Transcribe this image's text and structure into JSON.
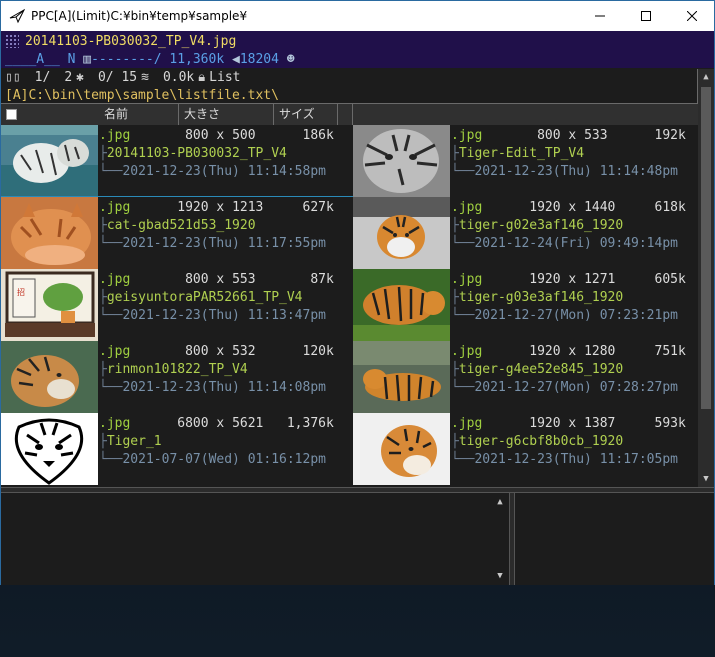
{
  "window": {
    "title": "PPC[A](Limit)C:¥bin¥temp¥sample¥",
    "icon": "paper-plane-icon",
    "minimize_icon": "minimize-icon",
    "maximize_icon": "maximize-icon",
    "close_icon": "close-icon"
  },
  "info": {
    "filename": "20141103-PB030032_TP_V4.jpg",
    "attr_line": "____A__ N ",
    "attr_rest": "--------/ 11,360k ",
    "attr_count": "18204"
  },
  "status": {
    "page": "1/",
    "marked": "2",
    "files": "0/ 15",
    "size": "0.0k",
    "mode": "List"
  },
  "path": "[A]C:\\bin\\temp\\sample\\listfile.txt\\",
  "columns": {
    "name": "名前",
    "size_wh": "大きさ",
    "size": "サイズ"
  },
  "entries": [
    {
      "ext": ".jpg",
      "dims": "800 x 500",
      "size": "186k",
      "name": "20141103-PB030032_TP_V4",
      "date": "2021-12-23(Thu) 11:14:58pm",
      "thumb": "white-tiger"
    },
    {
      "ext": ".jpg",
      "dims": "800 x 533",
      "size": "192k",
      "name": "Tiger-Edit_TP_V4",
      "date": "2021-12-23(Thu) 11:14:48pm",
      "thumb": "tiger-face-bw"
    },
    {
      "ext": ".jpg",
      "dims": "1920 x 1213",
      "size": "627k",
      "name": "cat-gbad521d53_1920",
      "date": "2021-12-23(Thu) 11:17:55pm",
      "thumb": "orange-cat"
    },
    {
      "ext": ".jpg",
      "dims": "1920 x 1440",
      "size": "618k",
      "name": "tiger-g02e3af146_1920",
      "date": "2021-12-24(Fri) 09:49:14pm",
      "thumb": "tiger-snow"
    },
    {
      "ext": ".jpg",
      "dims": "800 x 553",
      "size": "87k",
      "name": "geisyuntoraPAR52661_TP_V4",
      "date": "2021-12-23(Thu) 11:13:47pm",
      "thumb": "lucky-charm"
    },
    {
      "ext": ".jpg",
      "dims": "1920 x 1271",
      "size": "605k",
      "name": "tiger-g03e3af146_1920",
      "date": "2021-12-27(Mon) 07:23:21pm",
      "thumb": "tiger-grass"
    },
    {
      "ext": ".jpg",
      "dims": "800 x 532",
      "size": "120k",
      "name": "rinmon101822_TP_V4",
      "date": "2021-12-23(Thu) 11:14:08pm",
      "thumb": "tiger-side"
    },
    {
      "ext": ".jpg",
      "dims": "1920 x 1280",
      "size": "751k",
      "name": "tiger-g4ee52e845_1920",
      "date": "2021-12-27(Mon) 07:28:27pm",
      "thumb": "tiger-lying"
    },
    {
      "ext": ".jpg",
      "dims": "6800 x 5621",
      "size": "1,376k",
      "name": "Tiger_1",
      "date": "2021-07-07(Wed) 01:16:12pm",
      "thumb": "tiger-lineart"
    },
    {
      "ext": ".jpg",
      "dims": "1920 x 1387",
      "size": "593k",
      "name": "tiger-g6cbf8b0cb_1920",
      "date": "2021-12-23(Thu) 11:17:05pm",
      "thumb": "tiger-white-bg"
    }
  ],
  "colors": {
    "title_bg": "#ffffff",
    "info_bg": "#20104a",
    "filename": "#f0dc64",
    "ext": "#a0d040",
    "date": "#7890a8",
    "selection": "#2a8ab8"
  }
}
